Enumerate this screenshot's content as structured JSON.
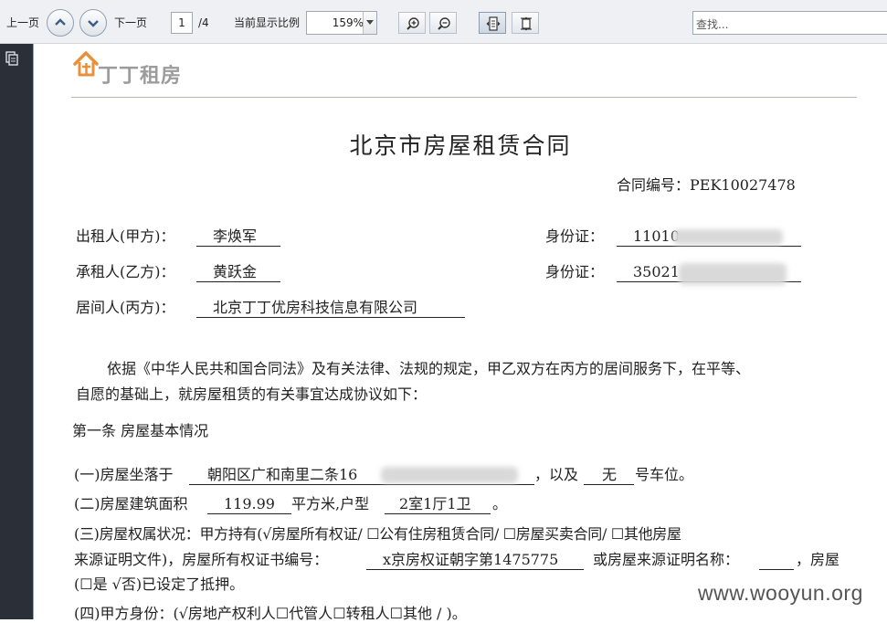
{
  "toolbar": {
    "prev_page": "上一页",
    "next_page": "下一页",
    "page_current": "1",
    "page_total": "/4",
    "zoom_label": "当前显示比例",
    "zoom_value": "159%",
    "search_placeholder": "查找..."
  },
  "logo": {
    "text": "丁丁租房"
  },
  "doc": {
    "title": "北京市房屋租赁合同",
    "contract_no": "合同编号：PEK10027478",
    "lessor_label": "出租人(甲方)：",
    "lessor_name": "李焕军",
    "lessee_label": "承租人(乙方)：",
    "lessee_name": "黄跃金",
    "agent_label": "居间人(丙方)：",
    "agent_name": "北京丁丁优房科技信息有限公司",
    "id_label": "身份证：",
    "lessor_id": "11010",
    "lessee_id": "35021",
    "intro_line1": "依据《中华人民共和国合同法》及有关法律、法规的规定，甲乙双方在丙方的居间服务下，在平等、",
    "intro_line2": "自愿的基础上，就房屋租赁的有关事宜达成协议如下：",
    "article1": "第一条  房屋基本情况",
    "c1_prefix": "(一)房屋坐落于",
    "c1_address": "朝阳区广和南里二条16",
    "c1_mid": "，以及",
    "c1_parking": "无",
    "c1_suffix": "号车位。",
    "c2_prefix": "(二)房屋建筑面积",
    "c2_area": "119.99",
    "c2_mid": "平方米,户型",
    "c2_layout": "2室1厅1卫",
    "c2_suffix": "。",
    "c3_line1": "(三)房屋权属状况：甲方持有(√房屋所有权证/   ☐公有住房租赁合同/   ☐房屋买卖合同/   ☐其他房屋",
    "c3_l2_prefix": "来源证明文件)，房屋所有权证书编号：",
    "c3_cert_no": "x京房权证朝字第1475775",
    "c3_l2_mid": "或房屋来源证明名称：",
    "c3_l2_suffix": "，房屋",
    "c3_line3": "(☐是    √否)已设定了抵押。",
    "c4_line": "(四)甲方身份：(√房地产权利人☐代管人☐转租人☐其他   /   )。"
  },
  "watermark": "www.wooyun.org"
}
